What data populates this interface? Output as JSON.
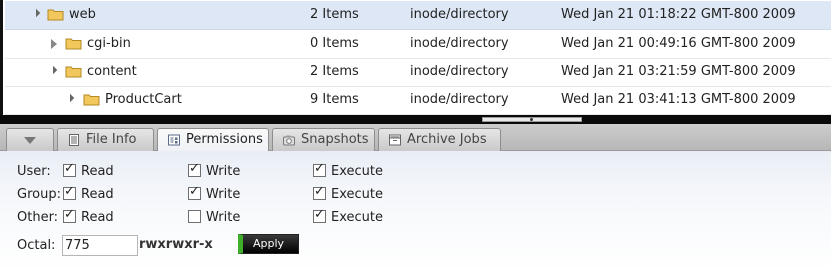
{
  "tree": {
    "rows": [
      {
        "name": "web",
        "items": "2 Items",
        "type": "inode/directory",
        "modified": "Wed Jan 21 01:18:22 GMT-800 2009",
        "expanded": true,
        "selected": true
      },
      {
        "name": "cgi-bin",
        "items": "0 Items",
        "type": "inode/directory",
        "modified": "Wed Jan 21 00:49:16 GMT-800 2009",
        "expanded": false,
        "selected": false
      },
      {
        "name": "content",
        "items": "2 Items",
        "type": "inode/directory",
        "modified": "Wed Jan 21 03:21:59 GMT-800 2009",
        "expanded": true,
        "selected": false
      },
      {
        "name": "ProductCart",
        "items": "9 Items",
        "type": "inode/directory",
        "modified": "Wed Jan 21 03:41:13 GMT-800 2009",
        "expanded": true,
        "selected": false
      }
    ]
  },
  "tabs": {
    "file_info": "File Info",
    "permissions": "Permissions",
    "snapshots": "Snapshots",
    "archive_jobs": "Archive Jobs",
    "active": "permissions"
  },
  "permissions": {
    "column_labels": {
      "read": "Read",
      "write": "Write",
      "execute": "Execute"
    },
    "rows": [
      {
        "label": "User:",
        "read": true,
        "write": true,
        "execute": true
      },
      {
        "label": "Group:",
        "read": true,
        "write": true,
        "execute": true
      },
      {
        "label": "Other:",
        "read": true,
        "write": false,
        "execute": true
      }
    ],
    "octal_label": "Octal:",
    "octal_value": "775",
    "symbolic": "rwxrwxr-x",
    "apply_label": "Apply"
  },
  "colors": {
    "selected_row": "#dde7f6",
    "apply_accent": "#3fae2a",
    "folder": "#f2c75c"
  }
}
